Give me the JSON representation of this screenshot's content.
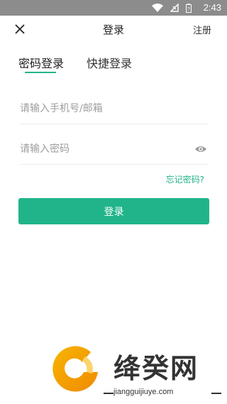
{
  "status_bar": {
    "time": "2:43",
    "icons": [
      "wifi-icon",
      "no-signal-icon",
      "battery-icon"
    ]
  },
  "app_bar": {
    "title": "登录",
    "register_label": "注册",
    "close_icon": "close-icon"
  },
  "tabs": [
    {
      "label": "密码登录",
      "active": true
    },
    {
      "label": "快捷登录",
      "active": false
    }
  ],
  "form": {
    "account_placeholder": "请输入手机号/邮箱",
    "password_placeholder": "请输入密码",
    "toggle_icon": "eye-icon",
    "forgot_label": "忘记密码?",
    "login_label": "登录"
  },
  "watermark": {
    "brand": "绛癸网",
    "site": "jiangguijiuye.com"
  },
  "colors": {
    "accent": "#21b48a",
    "status_bar": "#8c8c8c"
  }
}
